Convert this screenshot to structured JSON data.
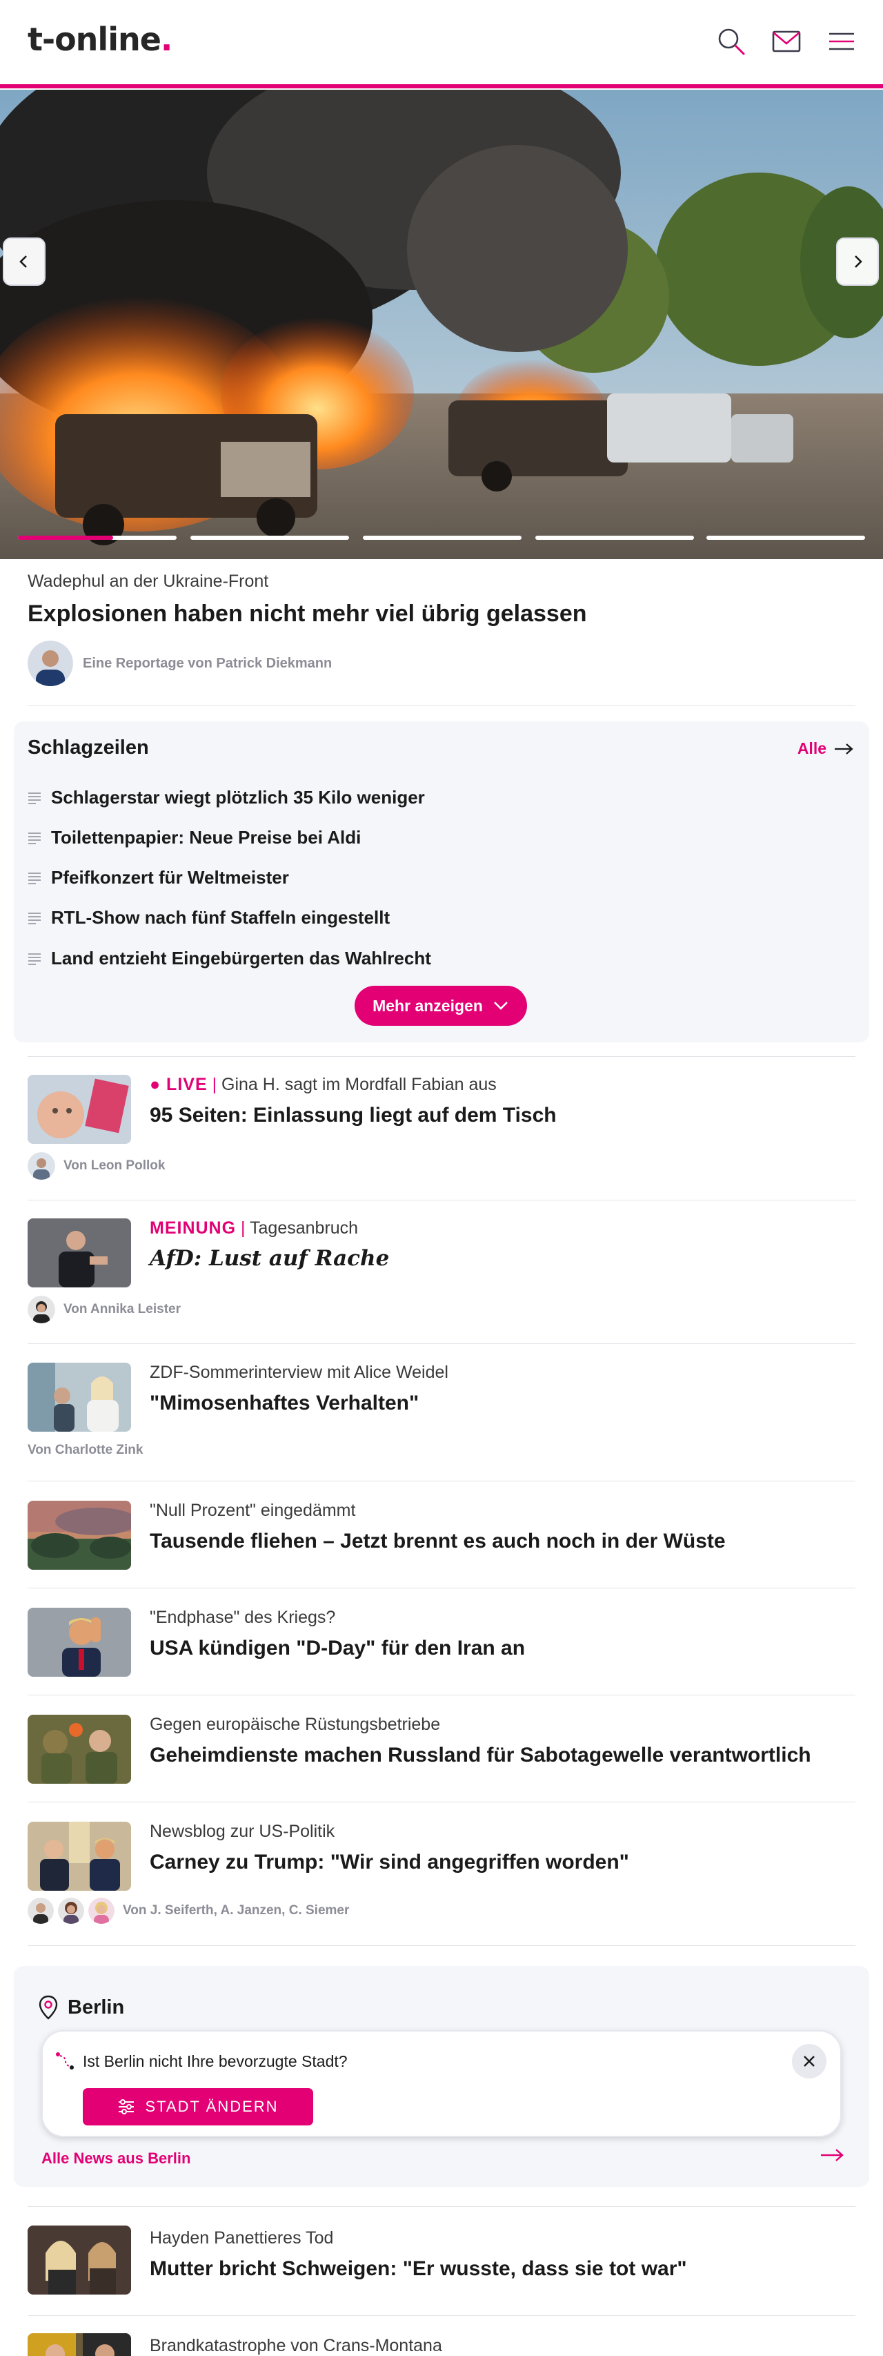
{
  "header": {
    "logo_text": "t-online",
    "logo_dot": ".",
    "icons": [
      "search-icon",
      "mail-icon",
      "menu-icon"
    ],
    "accent_color": "#e20074"
  },
  "hero": {
    "kicker": "Wadephul an der Ukraine-Front",
    "title": "Explosionen haben nicht mehr viel übrig gelassen",
    "author": "Eine Reportage von Patrick Diekmann",
    "slides_total": 5,
    "active_slide": 1
  },
  "headlines": {
    "title": "Schlagzeilen",
    "all_link": "Alle",
    "items": [
      "Schlagerstar wiegt plötzlich 35 Kilo weniger",
      "Toilettenpapier: Neue Preise bei Aldi",
      "Pfeifkonzert für Weltmeister",
      "RTL-Show nach fünf Staffeln eingestellt",
      "Land entzieht Eingebürgerten das Wahlrecht"
    ],
    "more_button": "Mehr anzeigen"
  },
  "articles": [
    {
      "label": "LIVE",
      "label_sep": "|",
      "kicker": "Gina H. sagt im Mordfall Fabian aus",
      "title": "95 Seiten: Einlassung liegt auf dem Tisch",
      "author": "Von Leon Pollok"
    },
    {
      "label": "MEINUNG",
      "label_sep": "|",
      "kicker": "Tagesanbruch",
      "title": "AfD: Lust auf Rache",
      "author": "Von Annika Leister"
    },
    {
      "kicker": "ZDF-Sommerinterview mit Alice Weidel",
      "title": "\"Mimosenhaftes Verhalten\"",
      "author": "Von Charlotte Zink"
    },
    {
      "kicker": "\"Null Prozent\" eingedämmt",
      "title": "Tausende fliehen – Jetzt brennt es auch noch in der Wüste"
    },
    {
      "kicker": "\"Endphase\" des Kriegs?",
      "title": "USA kündigen \"D-Day\" für den Iran an"
    },
    {
      "kicker": "Gegen europäische Rüstungsbetriebe",
      "title": "Geheimdienste machen Russland für Sabotagewelle verantwortlich"
    },
    {
      "kicker": "Newsblog zur US-Politik",
      "title": "Carney zu Trump: \"Wir sind angegriffen worden\"",
      "author": "Von J. Seiferth, A. Janzen, C. Siemer"
    }
  ],
  "berlin": {
    "title": "Berlin",
    "question": "Ist Berlin nicht Ihre bevorzugte Stadt?",
    "change_button": "STADT ÄNDERN",
    "all_news": "Alle News aus Berlin"
  },
  "more_articles": [
    {
      "kicker": "Hayden Panettieres Tod",
      "title": "Mutter bricht Schweigen: \"Er wusste, dass sie tot war\""
    },
    {
      "kicker": "Brandkatastrophe von Crans-Montana"
    }
  ]
}
